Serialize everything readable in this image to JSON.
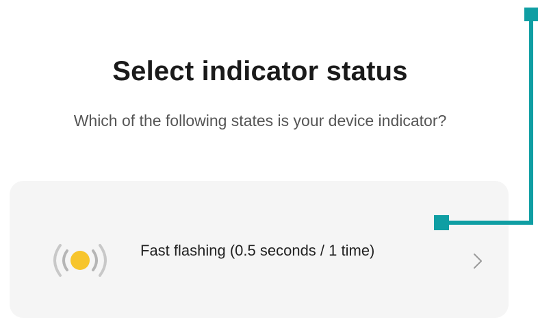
{
  "header": {
    "title": "Select indicator status",
    "subtitle": "Which of the following states is your device indicator?"
  },
  "options": [
    {
      "label": "Fast flashing (0.5 seconds / 1 time)",
      "icon": "flashing-light-icon",
      "action_icon": "chevron-right-icon"
    }
  ],
  "colors": {
    "card_background": "#f5f5f5",
    "indicator_dot": "#f7c52c",
    "callout": "#0f9ea3"
  }
}
